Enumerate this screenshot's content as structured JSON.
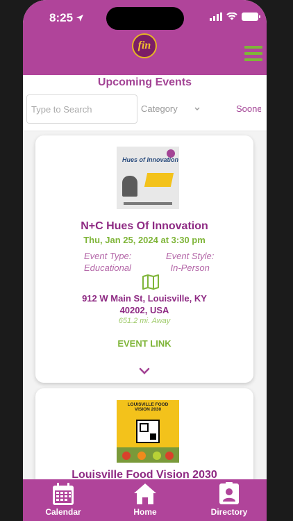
{
  "status_bar": {
    "time": "8:25"
  },
  "header": {
    "logo_text": "fin",
    "menu_icon": "hamburger-icon"
  },
  "page": {
    "title": "Upcoming Events"
  },
  "filters": {
    "search_placeholder": "Type to Search",
    "category_label": "Category",
    "sort_label": "Soonest"
  },
  "events": [
    {
      "poster_text": "Hues of Innovation",
      "title": "N+C Hues Of Innovation",
      "date": "Thu, Jan 25, 2024 at 3:30 pm",
      "type_label": "Event Type:",
      "type_value": "Educational",
      "style_label": "Event Style:",
      "style_value": "In-Person",
      "address_line1": "912 W Main St, Louisville, KY",
      "address_line2": "40202, USA",
      "distance": "651.2 mi. Away",
      "link_label": "EVENT LINK"
    },
    {
      "poster_text": "LOUISVILLE FOOD VISION 2030",
      "title": "Louisville Food Vision 2030"
    }
  ],
  "tabbar": {
    "items": [
      {
        "label": "Calendar",
        "icon": "calendar-icon"
      },
      {
        "label": "Home",
        "icon": "home-icon"
      },
      {
        "label": "Directory",
        "icon": "contact-card-icon"
      }
    ]
  },
  "colors": {
    "brand_purple": "#b0449a",
    "title_purple": "#8e2a83",
    "accent_green": "#7fb539"
  }
}
